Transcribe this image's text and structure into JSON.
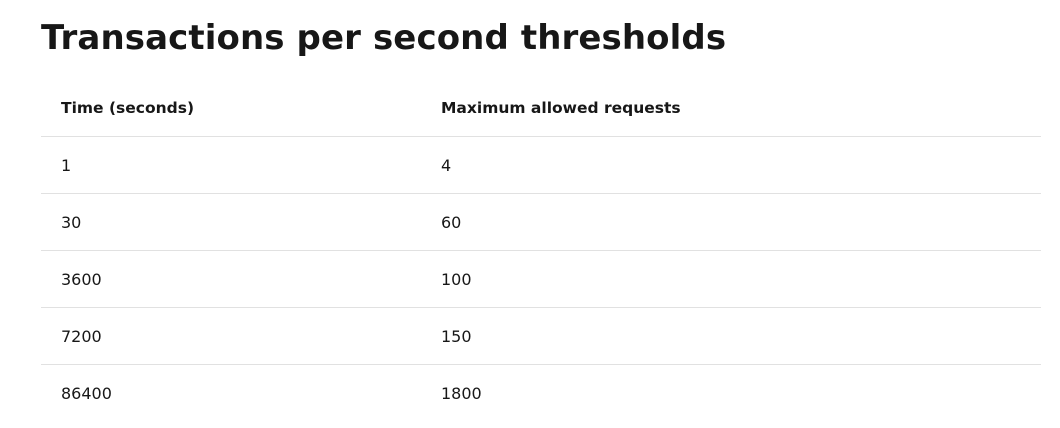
{
  "title": "Transactions per second thresholds",
  "table": {
    "headers": [
      "Time (seconds)",
      "Maximum allowed requests"
    ],
    "rows": [
      [
        "1",
        "4"
      ],
      [
        "30",
        "60"
      ],
      [
        "3600",
        "100"
      ],
      [
        "7200",
        "150"
      ],
      [
        "86400",
        "1800"
      ]
    ]
  }
}
